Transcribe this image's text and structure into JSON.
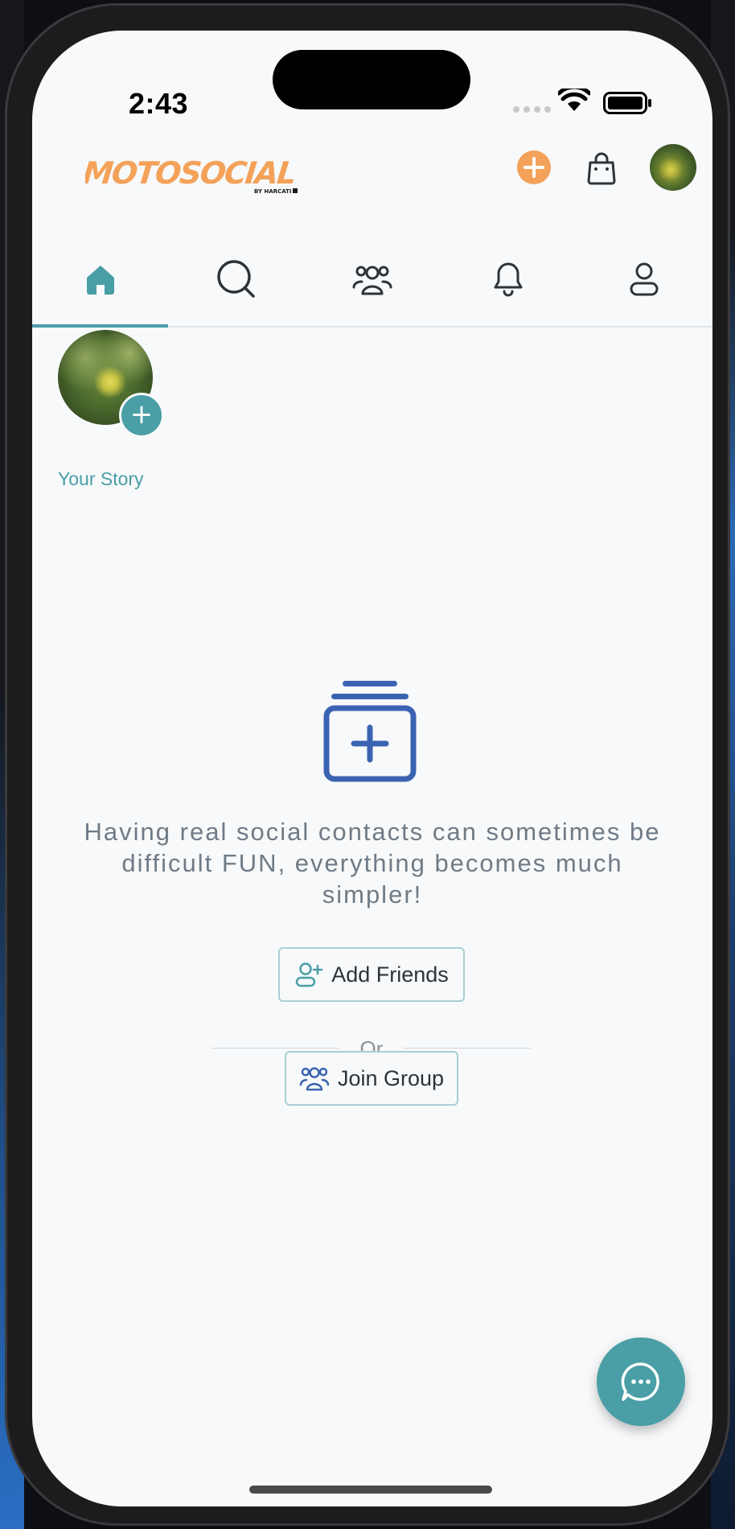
{
  "status_bar": {
    "time": "2:43"
  },
  "header": {
    "logo_text": "MOTOSOCIAL",
    "logo_subtext": "BY HARCATI",
    "create_icon": "plus-circle-icon",
    "bag_icon": "shopping-bag-icon"
  },
  "tabs": [
    {
      "name": "home",
      "icon": "home-icon",
      "active": true
    },
    {
      "name": "search",
      "icon": "search-icon",
      "active": false
    },
    {
      "name": "groups",
      "icon": "group-icon",
      "active": false
    },
    {
      "name": "notifications",
      "icon": "bell-icon",
      "active": false
    },
    {
      "name": "profile",
      "icon": "user-icon",
      "active": false
    }
  ],
  "story": {
    "label": "Your Story",
    "add_symbol": "+"
  },
  "empty_state": {
    "icon": "add-collection-icon",
    "message": "Having real social contacts can sometimes be difficult FUN, everything becomes much simpler!",
    "add_friends_label": "Add Friends",
    "or_label": "Or",
    "join_group_label": "Join Group"
  },
  "chat_button": {
    "icon": "chat-bubble-icon"
  },
  "colors": {
    "accent": "#4a9ea6",
    "brand_orange": "#f4a259",
    "icon_blue": "#3b63b2"
  }
}
